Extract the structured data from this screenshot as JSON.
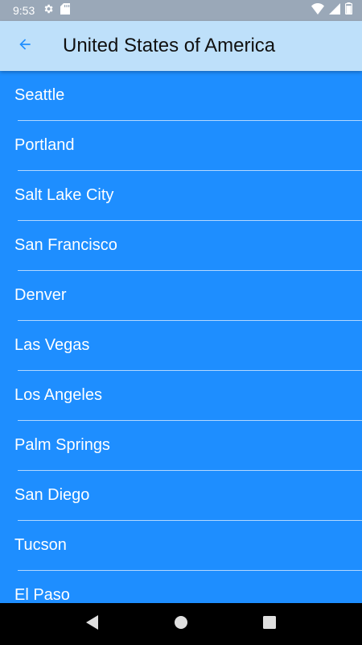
{
  "status_bar": {
    "time": "9:53",
    "icons": [
      "gear-icon",
      "sd-card-icon",
      "wifi-icon",
      "signal-icon",
      "battery-icon"
    ]
  },
  "app_bar": {
    "title": "United States of America",
    "back_icon": "arrow-back-icon"
  },
  "cities": [
    {
      "label": "Seattle"
    },
    {
      "label": "Portland"
    },
    {
      "label": "Salt Lake City"
    },
    {
      "label": "San Francisco"
    },
    {
      "label": "Denver"
    },
    {
      "label": "Las Vegas"
    },
    {
      "label": "Los Angeles"
    },
    {
      "label": "Palm Springs"
    },
    {
      "label": "San Diego"
    },
    {
      "label": "Tucson"
    },
    {
      "label": "El Paso"
    }
  ],
  "nav_bar": {
    "icons": [
      "back-triangle-icon",
      "home-circle-icon",
      "recents-square-icon"
    ]
  },
  "colors": {
    "list_background": "#1E8EFF",
    "app_bar_background": "#BEE0FA",
    "status_bar_background": "#9AA8B8",
    "accent": "#1E8EFF"
  }
}
